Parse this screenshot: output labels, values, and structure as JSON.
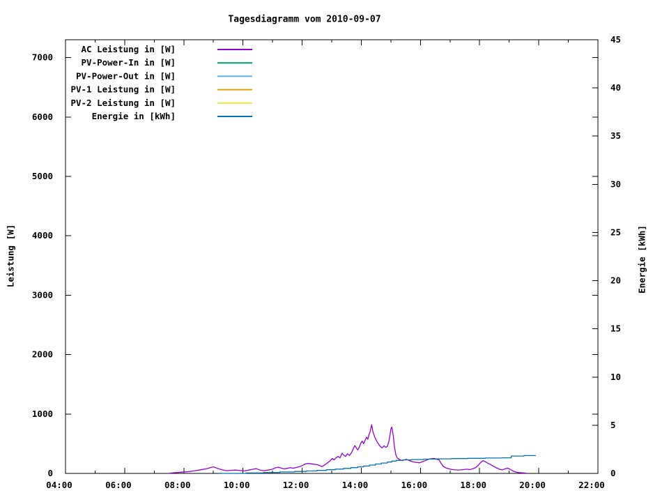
{
  "page": {
    "background": "#ffffff"
  },
  "chart_data": {
    "type": "line",
    "title": "Tagesdiagramm vom 2010-09-07",
    "grid": false,
    "legend": {
      "position": "top-left-inside"
    },
    "x_axis": {
      "range_hours": [
        4,
        22
      ],
      "major_ticks": [
        {
          "hour": 4,
          "label": "04:00"
        },
        {
          "hour": 6,
          "label": "06:00"
        },
        {
          "hour": 8,
          "label": "08:00"
        },
        {
          "hour": 10,
          "label": "10:00"
        },
        {
          "hour": 12,
          "label": "12:00"
        },
        {
          "hour": 14,
          "label": "14:00"
        },
        {
          "hour": 16,
          "label": "16:00"
        },
        {
          "hour": 18,
          "label": "18:00"
        },
        {
          "hour": 20,
          "label": "20:00"
        },
        {
          "hour": 22,
          "label": "22:00"
        }
      ],
      "minor_tick_hours": [
        5,
        7,
        9,
        11,
        13,
        15,
        17,
        19,
        21
      ]
    },
    "y1_axis": {
      "label": "Leistung [W]",
      "ticks": [
        0,
        1000,
        2000,
        3000,
        4000,
        5000,
        6000,
        7000
      ],
      "range": [
        0,
        7300
      ]
    },
    "y2_axis": {
      "label": "Energie [kWh]",
      "ticks": [
        0,
        5,
        10,
        15,
        20,
        25,
        30,
        35,
        40,
        45
      ],
      "range": [
        0,
        45
      ]
    },
    "series": [
      {
        "name": "AC Leistung in [W]",
        "color": "#9400d3",
        "axis": "y1",
        "points": [
          [
            7.5,
            2
          ],
          [
            7.6,
            8
          ],
          [
            7.75,
            14
          ],
          [
            7.9,
            20
          ],
          [
            8.05,
            26
          ],
          [
            8.2,
            32
          ],
          [
            8.35,
            42
          ],
          [
            8.5,
            55
          ],
          [
            8.65,
            68
          ],
          [
            8.8,
            82
          ],
          [
            8.9,
            98
          ],
          [
            9.0,
            110
          ],
          [
            9.1,
            92
          ],
          [
            9.2,
            75
          ],
          [
            9.3,
            60
          ],
          [
            9.45,
            46
          ],
          [
            9.6,
            52
          ],
          [
            9.75,
            56
          ],
          [
            9.9,
            48
          ],
          [
            10.05,
            42
          ],
          [
            10.2,
            56
          ],
          [
            10.35,
            72
          ],
          [
            10.45,
            80
          ],
          [
            10.55,
            60
          ],
          [
            10.7,
            46
          ],
          [
            10.85,
            56
          ],
          [
            11.0,
            72
          ],
          [
            11.1,
            95
          ],
          [
            11.2,
            105
          ],
          [
            11.3,
            88
          ],
          [
            11.4,
            76
          ],
          [
            11.5,
            86
          ],
          [
            11.6,
            96
          ],
          [
            11.7,
            88
          ],
          [
            11.8,
            100
          ],
          [
            11.9,
            112
          ],
          [
            12.0,
            132
          ],
          [
            12.1,
            158
          ],
          [
            12.2,
            168
          ],
          [
            12.3,
            162
          ],
          [
            12.4,
            155
          ],
          [
            12.5,
            148
          ],
          [
            12.6,
            132
          ],
          [
            12.67,
            115
          ],
          [
            12.75,
            138
          ],
          [
            12.85,
            175
          ],
          [
            12.95,
            215
          ],
          [
            13.02,
            250
          ],
          [
            13.08,
            228
          ],
          [
            13.15,
            265
          ],
          [
            13.22,
            285
          ],
          [
            13.28,
            260
          ],
          [
            13.35,
            340
          ],
          [
            13.4,
            310
          ],
          [
            13.47,
            285
          ],
          [
            13.53,
            330
          ],
          [
            13.6,
            302
          ],
          [
            13.67,
            350
          ],
          [
            13.73,
            415
          ],
          [
            13.78,
            470
          ],
          [
            13.83,
            432
          ],
          [
            13.88,
            395
          ],
          [
            13.93,
            440
          ],
          [
            13.98,
            505
          ],
          [
            14.03,
            545
          ],
          [
            14.08,
            500
          ],
          [
            14.13,
            560
          ],
          [
            14.18,
            610
          ],
          [
            14.22,
            575
          ],
          [
            14.26,
            650
          ],
          [
            14.3,
            705
          ],
          [
            14.35,
            820
          ],
          [
            14.4,
            690
          ],
          [
            14.45,
            620
          ],
          [
            14.5,
            560
          ],
          [
            14.57,
            505
          ],
          [
            14.63,
            460
          ],
          [
            14.7,
            430
          ],
          [
            14.77,
            465
          ],
          [
            14.83,
            438
          ],
          [
            14.88,
            455
          ],
          [
            14.93,
            530
          ],
          [
            14.97,
            640
          ],
          [
            15.0,
            745
          ],
          [
            15.03,
            780
          ],
          [
            15.08,
            640
          ],
          [
            15.12,
            450
          ],
          [
            15.17,
            310
          ],
          [
            15.22,
            258
          ],
          [
            15.3,
            232
          ],
          [
            15.38,
            215
          ],
          [
            15.45,
            228
          ],
          [
            15.52,
            238
          ],
          [
            15.6,
            222
          ],
          [
            15.68,
            205
          ],
          [
            15.77,
            192
          ],
          [
            15.87,
            185
          ],
          [
            15.97,
            178
          ],
          [
            16.07,
            198
          ],
          [
            16.17,
            216
          ],
          [
            16.27,
            238
          ],
          [
            16.37,
            248
          ],
          [
            16.47,
            252
          ],
          [
            16.55,
            240
          ],
          [
            16.63,
            228
          ],
          [
            16.7,
            168
          ],
          [
            16.78,
            115
          ],
          [
            16.87,
            90
          ],
          [
            16.97,
            76
          ],
          [
            17.07,
            66
          ],
          [
            17.17,
            60
          ],
          [
            17.27,
            57
          ],
          [
            17.37,
            60
          ],
          [
            17.47,
            66
          ],
          [
            17.57,
            72
          ],
          [
            17.67,
            65
          ],
          [
            17.77,
            78
          ],
          [
            17.87,
            100
          ],
          [
            17.97,
            145
          ],
          [
            18.05,
            190
          ],
          [
            18.12,
            215
          ],
          [
            18.2,
            196
          ],
          [
            18.28,
            170
          ],
          [
            18.37,
            150
          ],
          [
            18.47,
            120
          ],
          [
            18.57,
            94
          ],
          [
            18.67,
            70
          ],
          [
            18.77,
            60
          ],
          [
            18.87,
            78
          ],
          [
            18.95,
            88
          ],
          [
            19.03,
            70
          ],
          [
            19.12,
            42
          ],
          [
            19.22,
            24
          ],
          [
            19.32,
            14
          ],
          [
            19.45,
            9
          ],
          [
            19.58,
            4
          ]
        ]
      },
      {
        "name": "PV-Power-In in [W]",
        "color": "#009e73",
        "axis": "y1",
        "points": []
      },
      {
        "name": "PV-Power-Out in [W]",
        "color": "#56b4e9",
        "axis": "y1",
        "points": []
      },
      {
        "name": "PV-1 Leistung in [W]",
        "color": "#e69f00",
        "axis": "y1",
        "points": []
      },
      {
        "name": "PV-2 Leistung in [W]",
        "color": "#f0e442",
        "axis": "y1",
        "points": []
      },
      {
        "name": "Energie in [kWh]",
        "color": "#0072b2",
        "axis": "y2",
        "points": [
          [
            9.2,
            0
          ],
          [
            10.1,
            0
          ],
          [
            10.1,
            0.05
          ],
          [
            10.7,
            0.05
          ],
          [
            10.7,
            0.1
          ],
          [
            11.25,
            0.1
          ],
          [
            11.25,
            0.15
          ],
          [
            11.75,
            0.15
          ],
          [
            11.75,
            0.2
          ],
          [
            12.15,
            0.2
          ],
          [
            12.15,
            0.25
          ],
          [
            12.5,
            0.25
          ],
          [
            12.5,
            0.31
          ],
          [
            12.82,
            0.31
          ],
          [
            12.82,
            0.38
          ],
          [
            13.12,
            0.38
          ],
          [
            13.12,
            0.45
          ],
          [
            13.4,
            0.45
          ],
          [
            13.4,
            0.52
          ],
          [
            13.65,
            0.52
          ],
          [
            13.65,
            0.6
          ],
          [
            13.88,
            0.6
          ],
          [
            13.88,
            0.68
          ],
          [
            14.08,
            0.68
          ],
          [
            14.08,
            0.77
          ],
          [
            14.28,
            0.77
          ],
          [
            14.28,
            0.87
          ],
          [
            14.48,
            0.87
          ],
          [
            14.48,
            0.98
          ],
          [
            14.68,
            0.98
          ],
          [
            14.68,
            1.08
          ],
          [
            14.88,
            1.08
          ],
          [
            14.88,
            1.18
          ],
          [
            15.03,
            1.18
          ],
          [
            15.03,
            1.28
          ],
          [
            15.18,
            1.28
          ],
          [
            15.18,
            1.35
          ],
          [
            15.4,
            1.35
          ],
          [
            15.4,
            1.4
          ],
          [
            15.7,
            1.4
          ],
          [
            15.7,
            1.44
          ],
          [
            16.1,
            1.44
          ],
          [
            16.1,
            1.48
          ],
          [
            16.55,
            1.48
          ],
          [
            16.55,
            1.51
          ],
          [
            17.05,
            1.51
          ],
          [
            17.05,
            1.54
          ],
          [
            17.6,
            1.54
          ],
          [
            17.6,
            1.57
          ],
          [
            18.2,
            1.57
          ],
          [
            18.2,
            1.6
          ],
          [
            18.75,
            1.6
          ],
          [
            18.75,
            1.62
          ],
          [
            19.07,
            1.62
          ],
          [
            19.07,
            1.8
          ],
          [
            19.5,
            1.8
          ],
          [
            19.5,
            1.85
          ],
          [
            19.9,
            1.85
          ]
        ]
      }
    ]
  }
}
